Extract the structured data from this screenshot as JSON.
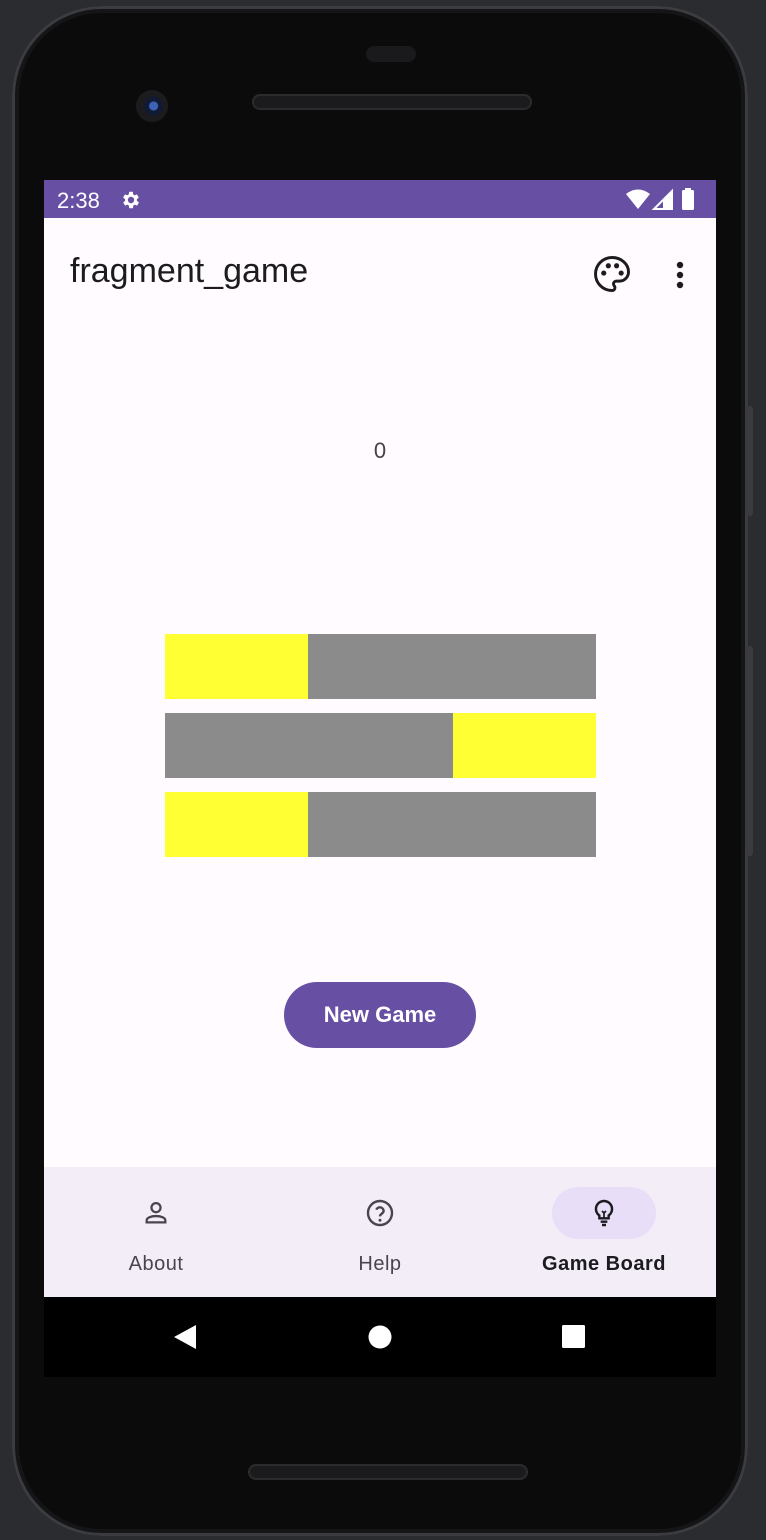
{
  "status_bar": {
    "time": "2:38",
    "background": "#6750a4"
  },
  "app_bar": {
    "title": "fragment_game",
    "actions": [
      "palette-icon",
      "more-vert-icon"
    ]
  },
  "game": {
    "score": "0",
    "rows": [
      {
        "highlight_segment": 1,
        "segments": 3
      },
      {
        "highlight_segment": 3,
        "segments": 3
      },
      {
        "highlight_segment": 1,
        "segments": 3
      }
    ],
    "highlight_color": "#ffff33",
    "bar_color": "#8b8b8b"
  },
  "new_game_button": {
    "label": "New Game",
    "color": "#6750a4"
  },
  "bottom_nav": {
    "items": [
      {
        "label": "About",
        "icon": "person-icon",
        "active": false
      },
      {
        "label": "Help",
        "icon": "help-circle-icon",
        "active": false
      },
      {
        "label": "Game Board",
        "icon": "lightbulb-icon",
        "active": true
      }
    ]
  },
  "system_nav": [
    "back-icon",
    "home-icon",
    "recents-icon"
  ]
}
